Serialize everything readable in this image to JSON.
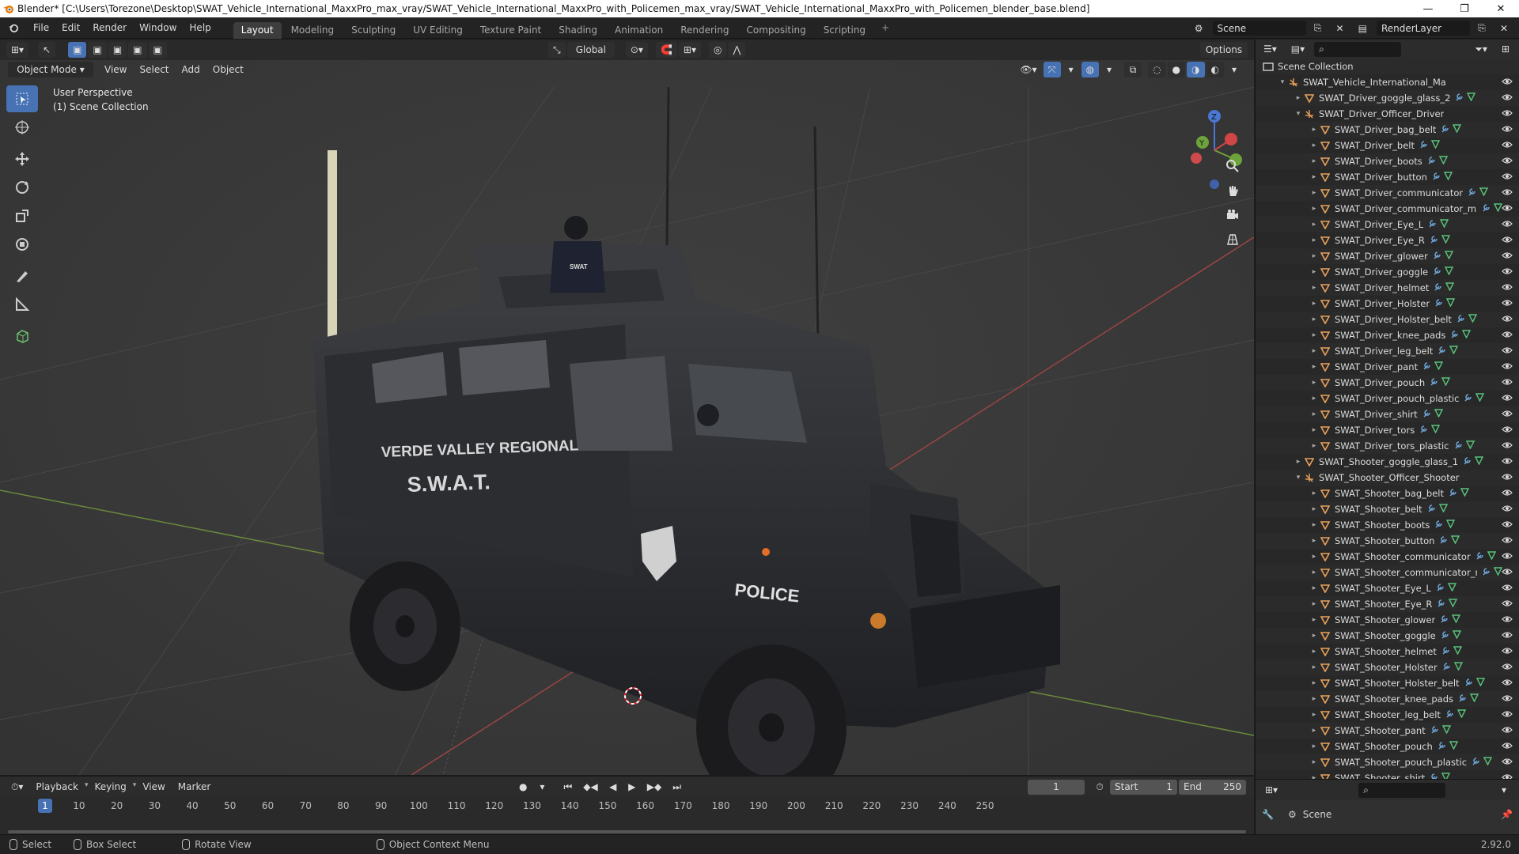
{
  "titlebar": {
    "title": "Blender* [C:\\Users\\Torezone\\Desktop\\SWAT_Vehicle_International_MaxxPro_max_vray/SWAT_Vehicle_International_MaxxPro_with_Policemen_max_vray/SWAT_Vehicle_International_MaxxPro_with_Policemen_blender_base.blend]"
  },
  "menu": [
    "File",
    "Edit",
    "Render",
    "Window",
    "Help"
  ],
  "workspaces": [
    {
      "label": "Layout",
      "active": true
    },
    {
      "label": "Modeling"
    },
    {
      "label": "Sculpting"
    },
    {
      "label": "UV Editing"
    },
    {
      "label": "Texture Paint"
    },
    {
      "label": "Shading"
    },
    {
      "label": "Animation"
    },
    {
      "label": "Rendering"
    },
    {
      "label": "Compositing"
    },
    {
      "label": "Scripting"
    }
  ],
  "topright": {
    "scene": "Scene",
    "render_layer": "RenderLayer"
  },
  "viewport": {
    "mode": "Object Mode",
    "menus": [
      "View",
      "Select",
      "Add",
      "Object"
    ],
    "orientation": "Global",
    "options": "Options",
    "perspective_label": "User Perspective",
    "collection_label": "(1) Scene Collection"
  },
  "vehicle": {
    "text1": "VERDE VALLEY REGIONAL",
    "text2": "S.W.A.T.",
    "text3": "POLICE",
    "text4": "SWAT"
  },
  "outliner": {
    "root": "Scene Collection",
    "rows": [
      {
        "name": "SWAT_Vehicle_International_MaxxPro_with_",
        "depth": 1,
        "arrow": "▾",
        "type": "empty"
      },
      {
        "name": "SWAT_Driver_goggle_glass_2",
        "depth": 2,
        "arrow": "▸",
        "type": "mesh"
      },
      {
        "name": "SWAT_Driver_Officer_Driver",
        "depth": 2,
        "arrow": "▾",
        "type": "empty"
      },
      {
        "name": "SWAT_Driver_bag_belt",
        "depth": 3,
        "arrow": "▸",
        "type": "mesh"
      },
      {
        "name": "SWAT_Driver_belt",
        "depth": 3,
        "arrow": "▸",
        "type": "mesh"
      },
      {
        "name": "SWAT_Driver_boots",
        "depth": 3,
        "arrow": "▸",
        "type": "mesh"
      },
      {
        "name": "SWAT_Driver_button",
        "depth": 3,
        "arrow": "▸",
        "type": "mesh"
      },
      {
        "name": "SWAT_Driver_communicator",
        "depth": 3,
        "arrow": "▸",
        "type": "mesh"
      },
      {
        "name": "SWAT_Driver_communicator_micro",
        "depth": 3,
        "arrow": "▸",
        "type": "mesh"
      },
      {
        "name": "SWAT_Driver_Eye_L",
        "depth": 3,
        "arrow": "▸",
        "type": "mesh"
      },
      {
        "name": "SWAT_Driver_Eye_R",
        "depth": 3,
        "arrow": "▸",
        "type": "mesh"
      },
      {
        "name": "SWAT_Driver_glower",
        "depth": 3,
        "arrow": "▸",
        "type": "mesh"
      },
      {
        "name": "SWAT_Driver_goggle",
        "depth": 3,
        "arrow": "▸",
        "type": "mesh"
      },
      {
        "name": "SWAT_Driver_helmet",
        "depth": 3,
        "arrow": "▸",
        "type": "mesh"
      },
      {
        "name": "SWAT_Driver_Holster",
        "depth": 3,
        "arrow": "▸",
        "type": "mesh"
      },
      {
        "name": "SWAT_Driver_Holster_belt",
        "depth": 3,
        "arrow": "▸",
        "type": "mesh"
      },
      {
        "name": "SWAT_Driver_knee_pads",
        "depth": 3,
        "arrow": "▸",
        "type": "mesh"
      },
      {
        "name": "SWAT_Driver_leg_belt",
        "depth": 3,
        "arrow": "▸",
        "type": "mesh"
      },
      {
        "name": "SWAT_Driver_pant",
        "depth": 3,
        "arrow": "▸",
        "type": "mesh"
      },
      {
        "name": "SWAT_Driver_pouch",
        "depth": 3,
        "arrow": "▸",
        "type": "mesh"
      },
      {
        "name": "SWAT_Driver_pouch_plastic",
        "depth": 3,
        "arrow": "▸",
        "type": "mesh"
      },
      {
        "name": "SWAT_Driver_shirt",
        "depth": 3,
        "arrow": "▸",
        "type": "mesh"
      },
      {
        "name": "SWAT_Driver_tors",
        "depth": 3,
        "arrow": "▸",
        "type": "mesh"
      },
      {
        "name": "SWAT_Driver_tors_plastic",
        "depth": 3,
        "arrow": "▸",
        "type": "mesh"
      },
      {
        "name": "SWAT_Shooter_goggle_glass_1",
        "depth": 2,
        "arrow": "▸",
        "type": "mesh"
      },
      {
        "name": "SWAT_Shooter_Officer_Shooter",
        "depth": 2,
        "arrow": "▾",
        "type": "empty"
      },
      {
        "name": "SWAT_Shooter_bag_belt",
        "depth": 3,
        "arrow": "▸",
        "type": "mesh"
      },
      {
        "name": "SWAT_Shooter_belt",
        "depth": 3,
        "arrow": "▸",
        "type": "mesh"
      },
      {
        "name": "SWAT_Shooter_boots",
        "depth": 3,
        "arrow": "▸",
        "type": "mesh"
      },
      {
        "name": "SWAT_Shooter_button",
        "depth": 3,
        "arrow": "▸",
        "type": "mesh"
      },
      {
        "name": "SWAT_Shooter_communicator",
        "depth": 3,
        "arrow": "▸",
        "type": "mesh"
      },
      {
        "name": "SWAT_Shooter_communicator_micr",
        "depth": 3,
        "arrow": "▸",
        "type": "mesh"
      },
      {
        "name": "SWAT_Shooter_Eye_L",
        "depth": 3,
        "arrow": "▸",
        "type": "mesh"
      },
      {
        "name": "SWAT_Shooter_Eye_R",
        "depth": 3,
        "arrow": "▸",
        "type": "mesh"
      },
      {
        "name": "SWAT_Shooter_glower",
        "depth": 3,
        "arrow": "▸",
        "type": "mesh"
      },
      {
        "name": "SWAT_Shooter_goggle",
        "depth": 3,
        "arrow": "▸",
        "type": "mesh"
      },
      {
        "name": "SWAT_Shooter_helmet",
        "depth": 3,
        "arrow": "▸",
        "type": "mesh"
      },
      {
        "name": "SWAT_Shooter_Holster",
        "depth": 3,
        "arrow": "▸",
        "type": "mesh"
      },
      {
        "name": "SWAT_Shooter_Holster_belt",
        "depth": 3,
        "arrow": "▸",
        "type": "mesh"
      },
      {
        "name": "SWAT_Shooter_knee_pads",
        "depth": 3,
        "arrow": "▸",
        "type": "mesh"
      },
      {
        "name": "SWAT_Shooter_leg_belt",
        "depth": 3,
        "arrow": "▸",
        "type": "mesh"
      },
      {
        "name": "SWAT_Shooter_pant",
        "depth": 3,
        "arrow": "▸",
        "type": "mesh"
      },
      {
        "name": "SWAT_Shooter_pouch",
        "depth": 3,
        "arrow": "▸",
        "type": "mesh"
      },
      {
        "name": "SWAT_Shooter_pouch_plastic",
        "depth": 3,
        "arrow": "▸",
        "type": "mesh"
      },
      {
        "name": "SWAT_Shooter_shirt",
        "depth": 3,
        "arrow": "▸",
        "type": "mesh"
      }
    ]
  },
  "properties": {
    "scene_label": "Scene"
  },
  "timeline": {
    "menus": [
      "Playback",
      "Keying",
      "View",
      "Marker"
    ],
    "current_frame": "1",
    "start_label": "Start",
    "start": "1",
    "end_label": "End",
    "end": "250",
    "ticks": [
      "1",
      "10",
      "20",
      "30",
      "40",
      "50",
      "60",
      "70",
      "80",
      "90",
      "100",
      "110",
      "120",
      "130",
      "140",
      "150",
      "160",
      "170",
      "180",
      "190",
      "200",
      "210",
      "220",
      "230",
      "240",
      "250"
    ]
  },
  "statusbar": {
    "items": [
      "Select",
      "Box Select",
      "Rotate View",
      "Object Context Menu"
    ],
    "version": "2.92.0"
  },
  "colors": {
    "accent": "#4772b3",
    "mesh_icon": "#e8a15a",
    "modifier_icon": "#6fa8dc",
    "data_icon": "#59c27a"
  }
}
